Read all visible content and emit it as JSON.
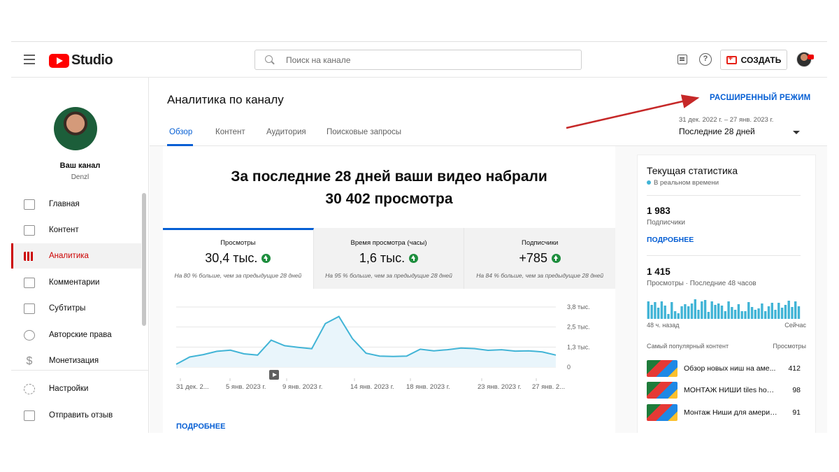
{
  "header": {
    "logo_text": "Studio",
    "search_placeholder": "Поиск на канале",
    "create_label": "СОЗДАТЬ",
    "help_glyph": "?"
  },
  "sidebar": {
    "channel_name": "Ваш канал",
    "channel_handle": "Denzl",
    "avatar_logo": "YouTube",
    "items": [
      {
        "label": "Главная",
        "icon": "dashboard-icon"
      },
      {
        "label": "Контент",
        "icon": "content-icon"
      },
      {
        "label": "Аналитика",
        "icon": "analytics-icon",
        "active": true
      },
      {
        "label": "Комментарии",
        "icon": "comments-icon"
      },
      {
        "label": "Субтитры",
        "icon": "subtitles-icon"
      },
      {
        "label": "Авторские права",
        "icon": "copyright-icon"
      },
      {
        "label": "Монетизация",
        "icon": "dollar-icon"
      }
    ],
    "bottom_items": [
      {
        "label": "Настройки",
        "icon": "gear-icon"
      },
      {
        "label": "Отправить отзыв",
        "icon": "feedback-icon"
      }
    ]
  },
  "main": {
    "title": "Аналитика по каналу",
    "tabs": [
      {
        "label": "Обзор",
        "active": true
      },
      {
        "label": "Контент"
      },
      {
        "label": "Аудитория"
      },
      {
        "label": "Поисковые запросы"
      }
    ],
    "advanced_mode": "РАСШИРЕННЫЙ РЕЖИМ",
    "date_range": "31 дек. 2022 г. – 27 янв. 2023 г.",
    "date_selected": "Последние 28 дней",
    "headline_line1": "За последние 28 дней ваши видео набрали",
    "headline_line2": "30 402 просмотра",
    "cards": [
      {
        "label": "Просмотры",
        "value": "30,4 тыс.",
        "note": "На 80 % больше, чем за предыдущие 28 дней"
      },
      {
        "label": "Время просмотра (часы)",
        "value": "1,6 тыс.",
        "note": "На 95 % больше, чем за предыдущие 28 дней"
      },
      {
        "label": "Подписчики",
        "value": "+785",
        "note": "На 84 % больше, чем за предыдущие 28 дней"
      }
    ],
    "more_link": "ПОДРОБНЕЕ"
  },
  "chart_data": {
    "type": "area",
    "x_tick_labels": [
      "31 дек. 2...",
      "5 янв. 2023 г.",
      "9 янв. 2023 г.",
      "14 янв. 2023 г.",
      "18 янв. 2023 г.",
      "23 янв. 2023 г.",
      "27 янв. 2..."
    ],
    "y_tick_labels": [
      "3,8 тыс.",
      "2,5 тыс.",
      "1,3 тыс.",
      "0"
    ],
    "ylim": [
      0,
      3800
    ],
    "values": [
      180,
      640,
      790,
      1000,
      1070,
      840,
      760,
      1700,
      1350,
      1250,
      1160,
      2750,
      3200,
      1800,
      880,
      700,
      670,
      700,
      1130,
      1030,
      1100,
      1200,
      1170,
      1060,
      1100,
      1010,
      1030,
      960,
      760
    ],
    "color": "#41b4d6",
    "fill": "#e9f5fb",
    "grid": true
  },
  "realtime": {
    "title": "Текущая статистика",
    "live_label": "В реальном времени",
    "subs_value": "1 983",
    "subs_label": "Подписчики",
    "more_link": "ПОДРОБНЕЕ",
    "views_value": "1 415",
    "views_label": "Просмотры · Последние 48 часов",
    "axis_left": "48 ч. назад",
    "axis_right": "Сейчас",
    "bars": [
      25,
      20,
      24,
      16,
      25,
      19,
      7,
      24,
      11,
      8,
      18,
      21,
      18,
      22,
      28,
      13,
      25,
      27,
      10,
      25,
      20,
      22,
      19,
      11,
      25,
      17,
      13,
      21,
      11,
      11,
      24,
      17,
      13,
      15,
      22,
      11,
      18,
      23,
      13,
      23,
      16,
      20,
      26,
      17,
      25,
      18
    ],
    "bar_color": "#41b4d6",
    "top_header_left": "Самый популярный контент",
    "top_header_right": "Просмотры",
    "videos": [
      {
        "title": "Обзор новых ниш на аме...",
        "views": "412"
      },
      {
        "title": "МОНТАЖ НИШИ tiles hop н...",
        "views": "98"
      },
      {
        "title": "Монтаж Ниши для америк...",
        "views": "91"
      }
    ]
  }
}
